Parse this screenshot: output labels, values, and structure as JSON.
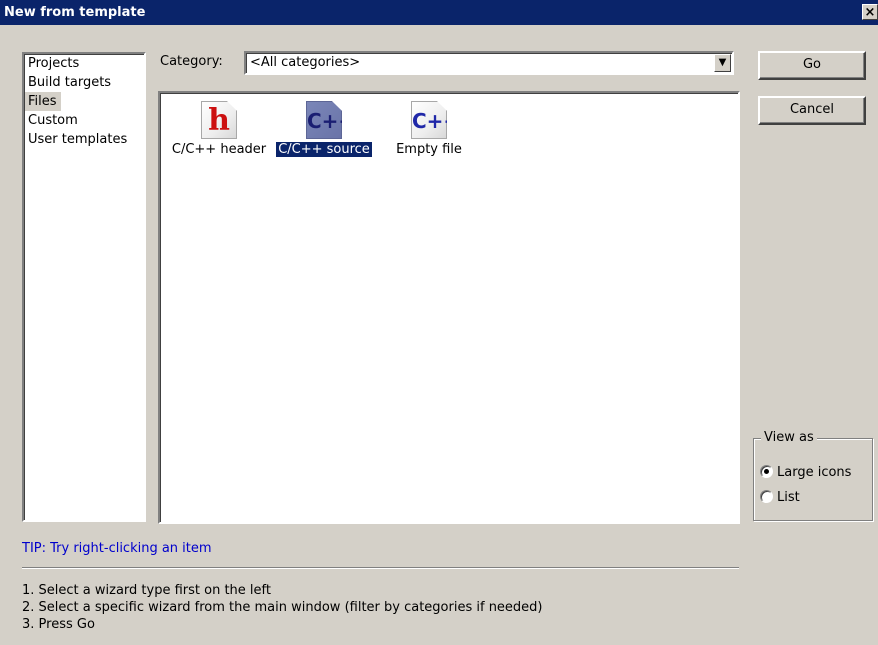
{
  "window": {
    "title": "New from template",
    "close_glyph": "×"
  },
  "wizard_types": {
    "items": [
      "Projects",
      "Build targets",
      "Files",
      "Custom",
      "User templates"
    ],
    "selected_index": 2
  },
  "category": {
    "label": "Category:",
    "value": "<All categories>"
  },
  "templates": [
    {
      "label": "C/C++ header",
      "icon": "c-header-file-icon",
      "glyph": "h",
      "selected": false
    },
    {
      "label": "C/C++ source",
      "icon": "cpp-source-file-icon",
      "glyph": "C++",
      "selected": true
    },
    {
      "label": "Empty file",
      "icon": "empty-file-icon",
      "glyph": "C++",
      "selected": false
    }
  ],
  "buttons": {
    "go": "Go",
    "cancel": "Cancel"
  },
  "view_as": {
    "title": "View as",
    "options": [
      "Large icons",
      "List"
    ],
    "selected": "Large icons"
  },
  "tip": "TIP: Try right-clicking an item",
  "instructions": [
    "1. Select a wizard type first on the left",
    "2. Select a specific wizard from the main window (filter by categories if needed)",
    "3. Press Go"
  ],
  "colors": {
    "titlebar": "#0a246a",
    "selection": "#0a246a",
    "tip_text": "#0000cc",
    "dialog_bg": "#d4d0c8",
    "header_glyph": "#cc1010",
    "cpp_glyph": "#2028a8"
  }
}
